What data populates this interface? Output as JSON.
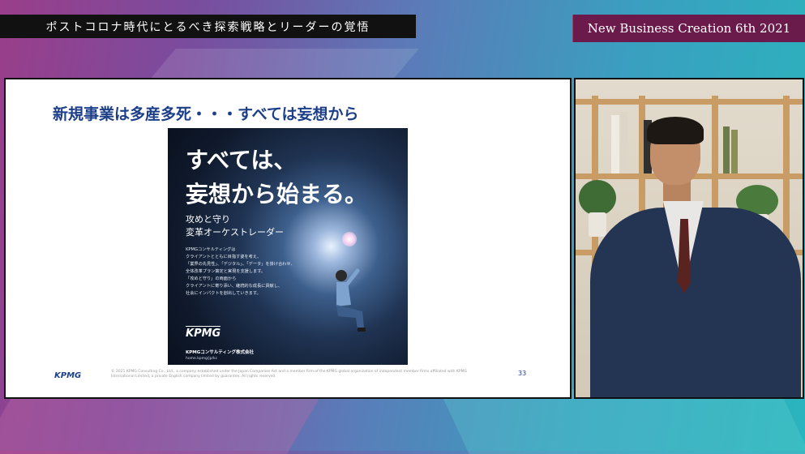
{
  "header": {
    "session_title": "ポストコロナ時代にとるべき探索戦略とリーダーの覚悟",
    "event_name": "New Business Creation 6th 2021"
  },
  "slide": {
    "heading": "新規事業は多産多死・・・すべては妄想から",
    "poster": {
      "headline_line1": "すべては、",
      "headline_line2": "妄想から始まる。",
      "sub_line1": "攻めと守り",
      "sub_line2": "変革オーケストレーダー",
      "body_lines": [
        "KPMGコンサルティングは",
        "クライアントとともに目指す姿を考え、",
        "「業界の先見性」、「デジタル」、「データ」を掛け合わせ、",
        "全体改革プラン策定と実現を支援します。",
        "「攻めと守り」の両面から",
        "クライアントに寄り添い、継続的な成長に貢献し、",
        "社会にインパクトを創出していきます。"
      ],
      "logo_text": "KPMG",
      "company_name": "KPMGコンサルティング株式会社",
      "url": "home.kpmg/jp/kc"
    },
    "footer_logo": "KPMG",
    "footer_legal": "© 2021 KPMG Consulting Co., Ltd., a company established under the Japan Companies Act and a member firm of the KPMG global organization of independent member firms affiliated with KPMG International Limited, a private English company limited by guarantee. All rights reserved.",
    "page_number": "33"
  },
  "colors": {
    "slide_heading": "#1d3f8a",
    "brand_bar": "#6b1b4b",
    "title_bar": "#111111"
  }
}
